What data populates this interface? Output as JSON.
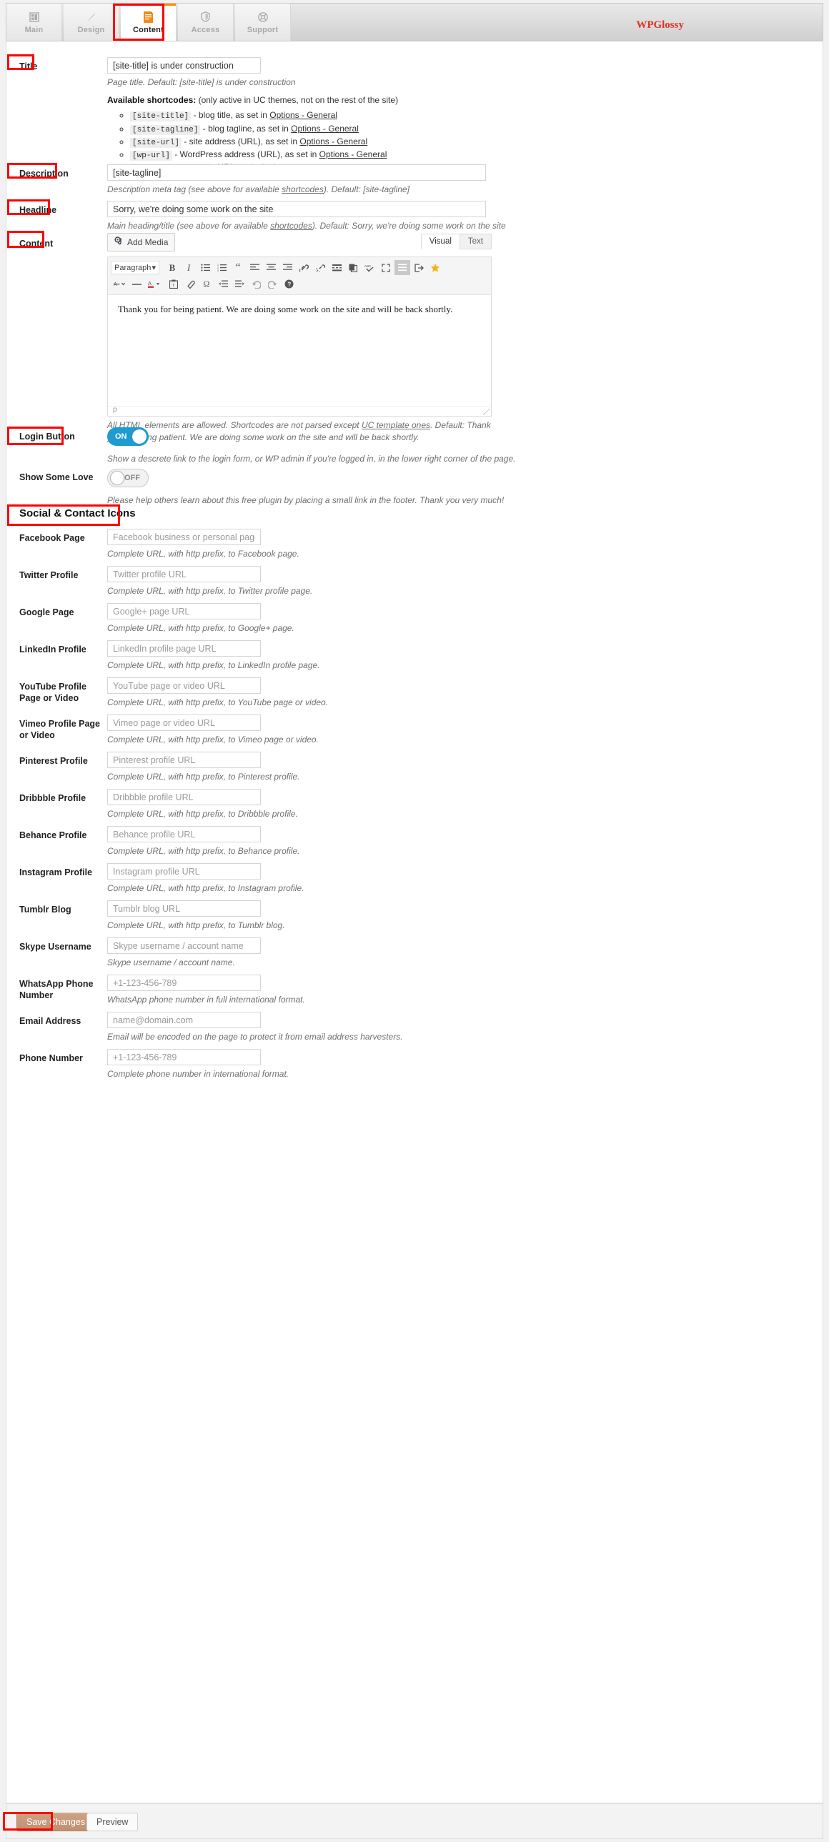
{
  "header": {
    "tabs": [
      {
        "label": "Main",
        "icon": "layout-icon",
        "active": false
      },
      {
        "label": "Design",
        "icon": "brush-icon",
        "active": false
      },
      {
        "label": "Content",
        "icon": "document-icon",
        "active": true
      },
      {
        "label": "Access",
        "icon": "shield-icon",
        "active": false
      },
      {
        "label": "Support",
        "icon": "lifebuoy-icon",
        "active": false
      }
    ],
    "brand": "WPGlossy",
    "brand_color": "#e03127"
  },
  "accent_color": "#ff8a00",
  "toggle_on_color": "#1e9bd0",
  "annotation_color": "#ff0000",
  "title_section": {
    "label": "Title",
    "value": "[site-title] is under construction",
    "hint": "Page title. Default: [site-title] is under construction",
    "shortcodes_head_bold": "Available shortcodes:",
    "shortcodes_head_rest": " (only active in UC themes, not on the rest of the site)",
    "shortcodes": [
      {
        "code": "[site-title]",
        "desc": " - blog title, as set in ",
        "link": "Options - General"
      },
      {
        "code": "[site-tagline]",
        "desc": " - blog tagline, as set in ",
        "link": "Options - General"
      },
      {
        "code": "[site-url]",
        "desc": " - site address (URL), as set in ",
        "link": "Options - General"
      },
      {
        "code": "[wp-url]",
        "desc": " - WordPress address (URL), as set in ",
        "link": "Options - General"
      },
      {
        "code": "[site-login-url]",
        "desc": " - URL to site login page",
        "link": ""
      }
    ]
  },
  "description_section": {
    "label": "Description",
    "value": "[site-tagline]",
    "hint_a": "Description meta tag (see above for available ",
    "hint_link": "shortcodes",
    "hint_b": "). Default: [site-tagline]"
  },
  "headline_section": {
    "label": "Headline",
    "value": "Sorry, we're doing some work on the site",
    "hint_a": "Main heading/title (see above for available ",
    "hint_link": "shortcodes",
    "hint_b": "). Default: Sorry, we're doing some work on the site"
  },
  "content_section": {
    "label": "Content",
    "add_media_label": "Add Media",
    "tab_visual": "Visual",
    "tab_text": "Text",
    "active_editor_tab": "Visual",
    "format_select": "Paragraph",
    "body": "Thank you for being patient. We are doing some work on the site and will be back shortly.",
    "path_indicator": "p",
    "hint_a": "All HTML elements are allowed. Shortcodes are not parsed except ",
    "hint_link": "UC template ones",
    "hint_b": ". Default: Thank you for being patient. We are doing some work on the site and will be back shortly.",
    "toolbar_row1": [
      "bold-icon",
      "italic-icon",
      "bulleted-list-icon",
      "numbered-list-icon",
      "blockquote-icon",
      "align-left-icon",
      "align-center-icon",
      "align-right-icon",
      "link-icon",
      "unlink-icon",
      "read-more-icon",
      "duplicate-icon",
      "spellcheck-icon",
      "fullscreen-icon",
      "toolbar-toggle-icon",
      "insert-icon",
      "star-icon"
    ],
    "toolbar_row2": [
      "strikethrough-icon",
      "horizontal-rule-icon",
      "text-color-icon",
      "paste-as-text-icon",
      "clear-formatting-icon",
      "special-character-icon",
      "outdent-icon",
      "indent-icon",
      "undo-icon",
      "redo-icon",
      "help-icon"
    ]
  },
  "login_button_section": {
    "label": "Login Button",
    "state": "ON",
    "hint": "Show a descrete link to the login form, or WP admin if you're logged in, in the lower right corner of the page."
  },
  "show_love_section": {
    "label": "Show Some Love",
    "state": "OFF",
    "hint": "Please help others learn about this free plugin by placing a small link in the footer. Thank you very much!"
  },
  "social_section": {
    "heading": "Social & Contact Icons",
    "fields": [
      {
        "label": "Facebook Page",
        "placeholder": "Facebook business or personal page URL",
        "hint": "Complete URL, with http prefix, to Facebook page."
      },
      {
        "label": "Twitter Profile",
        "placeholder": "Twitter profile URL",
        "hint": "Complete URL, with http prefix, to Twitter profile page."
      },
      {
        "label": "Google Page",
        "placeholder": "Google+ page URL",
        "hint": "Complete URL, with http prefix, to Google+ page."
      },
      {
        "label": "LinkedIn Profile",
        "placeholder": "LinkedIn profile page URL",
        "hint": "Complete URL, with http prefix, to LinkedIn profile page."
      },
      {
        "label": "YouTube Profile Page or Video",
        "placeholder": "YouTube page or video URL",
        "hint": "Complete URL, with http prefix, to YouTube page or video."
      },
      {
        "label": "Vimeo Profile Page or Video",
        "placeholder": "Vimeo page or video URL",
        "hint": "Complete URL, with http prefix, to Vimeo page or video."
      },
      {
        "label": "Pinterest Profile",
        "placeholder": "Pinterest profile URL",
        "hint": "Complete URL, with http prefix, to Pinterest profile."
      },
      {
        "label": "Dribbble Profile",
        "placeholder": "Dribbble profile URL",
        "hint": "Complete URL, with http prefix, to Dribbble profile."
      },
      {
        "label": "Behance Profile",
        "placeholder": "Behance profile URL",
        "hint": "Complete URL, with http prefix, to Behance profile."
      },
      {
        "label": "Instagram Profile",
        "placeholder": "Instagram profile URL",
        "hint": "Complete URL, with http prefix, to Instagram profile."
      },
      {
        "label": "Tumblr Blog",
        "placeholder": "Tumblr blog URL",
        "hint": "Complete URL, with http prefix, to Tumblr blog."
      },
      {
        "label": "Skype Username",
        "placeholder": "Skype username / account name",
        "hint": "Skype username / account name."
      },
      {
        "label": "WhatsApp Phone Number",
        "placeholder": "+1-123-456-789",
        "hint": "WhatsApp phone number in full international format."
      },
      {
        "label": "Email Address",
        "placeholder": "name@domain.com",
        "hint": "Email will be encoded on the page to protect it from email address harvesters."
      },
      {
        "label": "Phone Number",
        "placeholder": "+1-123-456-789",
        "hint": "Complete phone number in international format."
      }
    ]
  },
  "footer": {
    "save_label": "Save Changes",
    "preview_label": "Preview"
  }
}
